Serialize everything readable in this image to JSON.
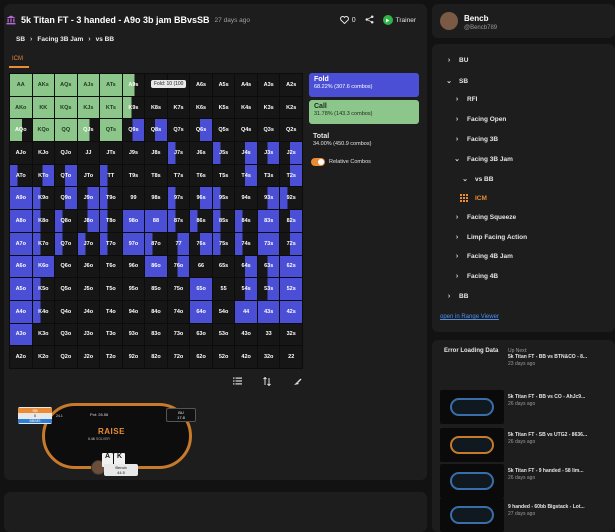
{
  "header": {
    "title": "5k Titan FT - 3 handed - A9o 3b jam BBvsSB",
    "time": "27 days ago",
    "likes": "0",
    "trainer_label": "Trainer"
  },
  "breadcrumb": [
    "SB",
    "Facing 3B Jam",
    "vs BB"
  ],
  "tab": "ICM",
  "tooltip": "Fold: 10 (100",
  "grid": [
    [
      "AA",
      "AKs",
      "AQs",
      "AJs",
      "ATs",
      "A9s",
      "A8s",
      "A7s",
      "A6s",
      "A5s",
      "A4s",
      "A3s",
      "A2s"
    ],
    [
      "AKo",
      "KK",
      "KQs",
      "KJs",
      "KTs",
      "K9s",
      "K8s",
      "K7s",
      "K6s",
      "K5s",
      "K4s",
      "K3s",
      "K2s"
    ],
    [
      "AQo",
      "KQo",
      "QQ",
      "QJs",
      "QTs",
      "Q9s",
      "Q8s",
      "Q7s",
      "Q6s",
      "Q5s",
      "Q4s",
      "Q3s",
      "Q2s"
    ],
    [
      "AJo",
      "KJo",
      "QJo",
      "JJ",
      "JTs",
      "J9s",
      "J8s",
      "J7s",
      "J6s",
      "J5s",
      "J4s",
      "J3s",
      "J2s"
    ],
    [
      "ATo",
      "KTo",
      "QTo",
      "JTo",
      "TT",
      "T9s",
      "T8s",
      "T7s",
      "T6s",
      "T5s",
      "T4s",
      "T3s",
      "T2s"
    ],
    [
      "A9o",
      "K9o",
      "Q9o",
      "J9o",
      "T9o",
      "99",
      "98s",
      "97s",
      "96s",
      "95s",
      "94s",
      "93s",
      "92s"
    ],
    [
      "A8o",
      "K8o",
      "Q8o",
      "J8o",
      "T8o",
      "98o",
      "88",
      "87s",
      "86s",
      "85s",
      "84s",
      "83s",
      "82s"
    ],
    [
      "A7o",
      "K7o",
      "Q7o",
      "J7o",
      "T7o",
      "97o",
      "87o",
      "77",
      "76s",
      "75s",
      "74s",
      "73s",
      "72s"
    ],
    [
      "A6o",
      "K6o",
      "Q6o",
      "J6o",
      "T6o",
      "96o",
      "86o",
      "76o",
      "66",
      "65s",
      "64s",
      "63s",
      "62s"
    ],
    [
      "A5o",
      "K5o",
      "Q5o",
      "J5o",
      "T5o",
      "95o",
      "85o",
      "75o",
      "65o",
      "55",
      "54s",
      "53s",
      "52s"
    ],
    [
      "A4o",
      "K4o",
      "Q4o",
      "J4o",
      "T4o",
      "94o",
      "84o",
      "74o",
      "64o",
      "54o",
      "44",
      "43s",
      "42s"
    ],
    [
      "A3o",
      "K3o",
      "Q3o",
      "J3o",
      "T3o",
      "93o",
      "83o",
      "73o",
      "63o",
      "53o",
      "43o",
      "33",
      "32s"
    ],
    [
      "A2o",
      "K2o",
      "Q2o",
      "J2o",
      "T2o",
      "92o",
      "82o",
      "72o",
      "62o",
      "52o",
      "42o",
      "32o",
      "22"
    ]
  ],
  "grid_actions": [
    [
      "f",
      "f",
      "f",
      "f",
      "f",
      "fc",
      "n",
      "n",
      "n",
      "n",
      "n",
      "n",
      "n"
    ],
    [
      "f",
      "f",
      "f",
      "f",
      "f",
      "fch",
      "n",
      "n",
      "n",
      "n",
      "n",
      "n",
      "n"
    ],
    [
      "fc",
      "f",
      "f",
      "fc",
      "f",
      "cc",
      "cc",
      "n",
      "cc",
      "n",
      "n",
      "n",
      "n"
    ],
    [
      "n",
      "n",
      "n",
      "n",
      "n",
      "n",
      "n",
      "c2",
      "n",
      "c2",
      "cc",
      "cc",
      "cc"
    ],
    [
      "c2",
      "cc",
      "cc",
      "n",
      "c2",
      "n",
      "n",
      "n",
      "n",
      "n",
      "cc",
      "n",
      "cc"
    ],
    [
      "c",
      "c2",
      "cc",
      "cc",
      "c2",
      "n",
      "n",
      "c2",
      "cc",
      "c2",
      "n",
      "cc",
      "c2"
    ],
    [
      "c",
      "c2",
      "c2",
      "cc",
      "c2",
      "c",
      "c",
      "c2",
      "c2",
      "c2",
      "c2",
      "c",
      "cc"
    ],
    [
      "c",
      "c2",
      "c2",
      "c2",
      "c2",
      "c",
      "c2",
      "cc",
      "cc",
      "c2",
      "c2",
      "c",
      "cc"
    ],
    [
      "c",
      "c",
      "n",
      "n",
      "n",
      "n",
      "c",
      "cc",
      "n",
      "n",
      "cc",
      "cc",
      "c"
    ],
    [
      "c",
      "c2",
      "n",
      "n",
      "n",
      "n",
      "n",
      "n",
      "c",
      "n",
      "cc",
      "cc",
      "c"
    ],
    [
      "c",
      "c2",
      "n",
      "n",
      "n",
      "n",
      "n",
      "n",
      "c",
      "n",
      "c",
      "c",
      "c"
    ],
    [
      "c",
      "n",
      "n",
      "n",
      "n",
      "n",
      "n",
      "n",
      "n",
      "n",
      "n",
      "n",
      "n"
    ],
    [
      "n",
      "n",
      "n",
      "n",
      "n",
      "n",
      "n",
      "n",
      "n",
      "n",
      "n",
      "n",
      "n"
    ]
  ],
  "legend": {
    "fold_name": "Fold",
    "fold_val": "68.22% (307.6 combos)",
    "call_name": "Call",
    "call_val": "31.78% (143.3 combos)",
    "total_name": "Total",
    "total_val": "34.00% (450.9 combos)",
    "relative_label": "Relative Combos"
  },
  "table": {
    "sb_pos": "SB",
    "sb_stack": "0",
    "sb_tag": "BB/MS",
    "sb_amt": "24.1",
    "bu_pos": "BU",
    "bu_stack": "17.8",
    "pot": "Pot: 26.56",
    "brand": "RAISE",
    "brand_sub": "SOLVER",
    "hero_bet": "0.46",
    "hero_name": "Bencb",
    "hero_stack": "44.5",
    "card1": "A",
    "card2": "K"
  },
  "profile": {
    "name": "Bencb",
    "handle": "@Bencb789"
  },
  "tree": {
    "items": [
      "BU",
      "SB",
      "RFI",
      "Facing Open",
      "Facing 3B",
      "Facing 3B Jam",
      "vs BB",
      "ICM",
      "Facing Squeeze",
      "Limp Facing Action",
      "Facing 4B Jam",
      "Facing 4B",
      "BB"
    ],
    "open_link": "open in Range Viewer"
  },
  "upnext": {
    "error": "Error Loading Data",
    "label": "Up Next:",
    "items": [
      {
        "title": "5k Titan FT - BB vs BTN&CO - 8...",
        "date": "23 days ago"
      },
      {
        "title": "5k Titan FT - BB vs CO - AhJc9...",
        "date": "26 days ago"
      },
      {
        "title": "5k Titan FT - SB vs UTG2 - 8636...",
        "date": "26 days ago"
      },
      {
        "title": "5k Titan FT - 9 handed - 58 lim...",
        "date": "26 days ago"
      },
      {
        "title": "9 handed - 60bb Bigstack - Lot...",
        "date": "27 days ago"
      }
    ]
  }
}
